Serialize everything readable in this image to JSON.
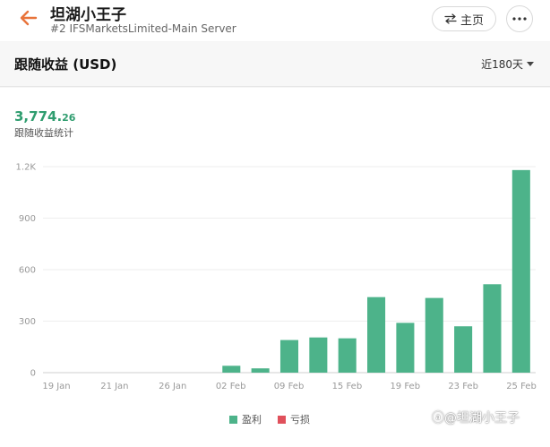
{
  "header": {
    "title": "坦湖小王子",
    "subtitle": "#2  IFSMarketsLimited-Main Server",
    "home_label": "主页"
  },
  "section": {
    "title": "跟随收益 (USD)",
    "range_label": "近180天"
  },
  "summary": {
    "total_int": "3,774.",
    "total_dec": "26",
    "label": "跟随收益统计"
  },
  "legend": {
    "profit": "盈利",
    "loss": "亏损"
  },
  "watermark": "ⓐ@坦湖小王子",
  "colors": {
    "profit": "#4db38a",
    "loss": "#e0505b",
    "back_arrow": "#e8743b"
  },
  "chart_data": {
    "type": "bar",
    "x_tick_labels": [
      "19 Jan",
      "21 Jan",
      "26 Jan",
      "02 Feb",
      "09 Feb",
      "15 Feb",
      "19 Feb",
      "23 Feb",
      "25 Feb"
    ],
    "y_tick_labels": [
      "0",
      "300",
      "600",
      "900",
      "1.2K"
    ],
    "ylim": [
      0,
      1200
    ],
    "grid": "horizontal",
    "legend_position": "bottom",
    "series": [
      {
        "name": "盈利",
        "values": [
          0,
          0,
          0,
          0,
          0,
          0,
          40,
          25,
          190,
          205,
          200,
          440,
          290,
          435,
          270,
          515,
          1180
        ]
      },
      {
        "name": "亏损",
        "values": []
      }
    ]
  }
}
